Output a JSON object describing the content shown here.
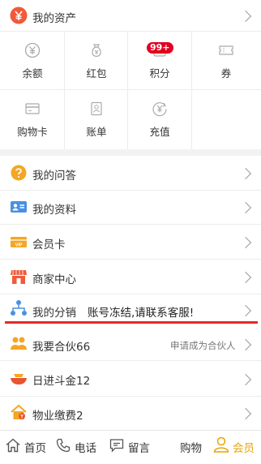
{
  "assets": {
    "title": "我的资产",
    "icon": "yuan-circle-icon",
    "color": "#f05a3a"
  },
  "grid": {
    "items": [
      {
        "label": "余额",
        "icon": "wallet-yuan-icon"
      },
      {
        "label": "红包",
        "icon": "money-bag-icon"
      },
      {
        "label": "积分",
        "icon": "points-icon",
        "badge": "99+"
      },
      {
        "label": "券",
        "icon": "coupon-icon"
      },
      {
        "label": "购物卡",
        "icon": "card-icon"
      },
      {
        "label": "账单",
        "icon": "bill-icon"
      },
      {
        "label": "充值",
        "icon": "recharge-icon"
      }
    ]
  },
  "menu": [
    {
      "label": "我的问答",
      "icon": "question-circle-icon"
    },
    {
      "label": "我的资料",
      "icon": "profile-card-icon"
    },
    {
      "label": "会员卡",
      "icon": "vip-card-icon"
    },
    {
      "label": "商家中心",
      "icon": "store-icon"
    },
    {
      "label": "我的分销",
      "icon": "share-tree-icon",
      "notice": "账号冻结,请联系客服!"
    },
    {
      "label": "我要合伙66",
      "icon": "partners-icon",
      "extra": "申请成为合伙人"
    },
    {
      "label": "日进斗金12",
      "icon": "gold-bowl-icon"
    },
    {
      "label": "物业缴费2",
      "icon": "house-bill-icon"
    }
  ],
  "tabbar": {
    "home": "首页",
    "phone": "电话",
    "message": "留言",
    "shop": "购物",
    "member": "会员",
    "active_color": "#e9a300"
  }
}
